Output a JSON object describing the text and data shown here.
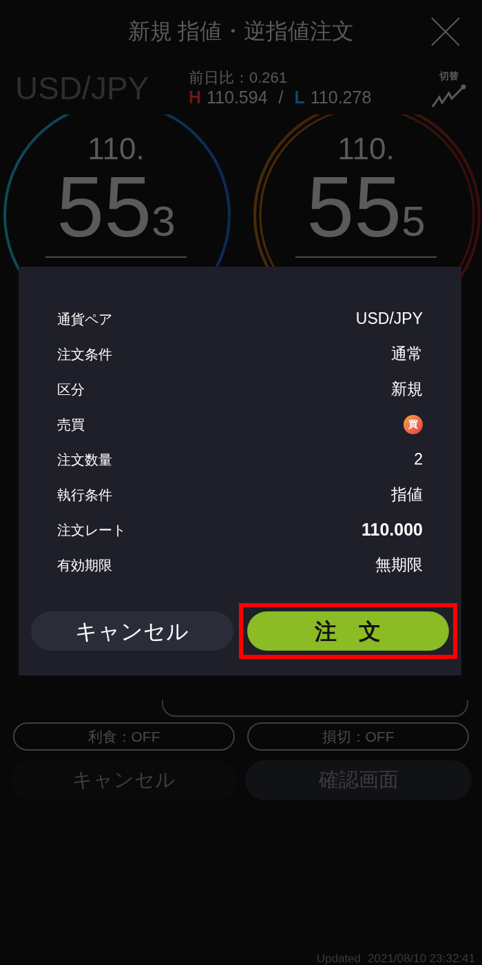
{
  "header": {
    "title": "新規 指値・逆指値注文"
  },
  "ticker": {
    "pair": "USD/JPY",
    "change_label": "前日比",
    "change_colon": "：",
    "change_value": "0.261",
    "high_mark": "H",
    "high": "110.594",
    "separator": "/",
    "low_mark": "L",
    "low": "110.278",
    "switch_label": "切替"
  },
  "prices": [
    {
      "kind": "bid",
      "head": "110.",
      "big": "55",
      "small": "3"
    },
    {
      "kind": "ask",
      "head": "110.",
      "big": "55",
      "small": "5"
    }
  ],
  "toggles": [
    {
      "label": "利食：OFF"
    },
    {
      "label": "損切：OFF"
    }
  ],
  "form_buttons": [
    {
      "label": "キャンセル",
      "kind": "cancel"
    },
    {
      "label": "確認画面",
      "kind": "confirm"
    }
  ],
  "updated": {
    "label": "Updated",
    "time": "2021/08/10 23:32:41"
  },
  "dialog": {
    "rows": [
      {
        "label": "通貨ペア",
        "value": "USD/JPY",
        "kind": "text"
      },
      {
        "label": "注文条件",
        "value": "通常",
        "kind": "text"
      },
      {
        "label": "区分",
        "value": "新規",
        "kind": "text"
      },
      {
        "label": "売買",
        "value": "買",
        "kind": "badge"
      },
      {
        "label": "注文数量",
        "value": "2",
        "kind": "text"
      },
      {
        "label": "執行条件",
        "value": "指値",
        "kind": "text"
      },
      {
        "label": "注文レート",
        "value": "110.000",
        "kind": "strong"
      },
      {
        "label": "有効期限",
        "value": "無期限",
        "kind": "text"
      }
    ],
    "cancel": "キャンセル",
    "submit": "注　文",
    "submit_highlighted": true
  }
}
